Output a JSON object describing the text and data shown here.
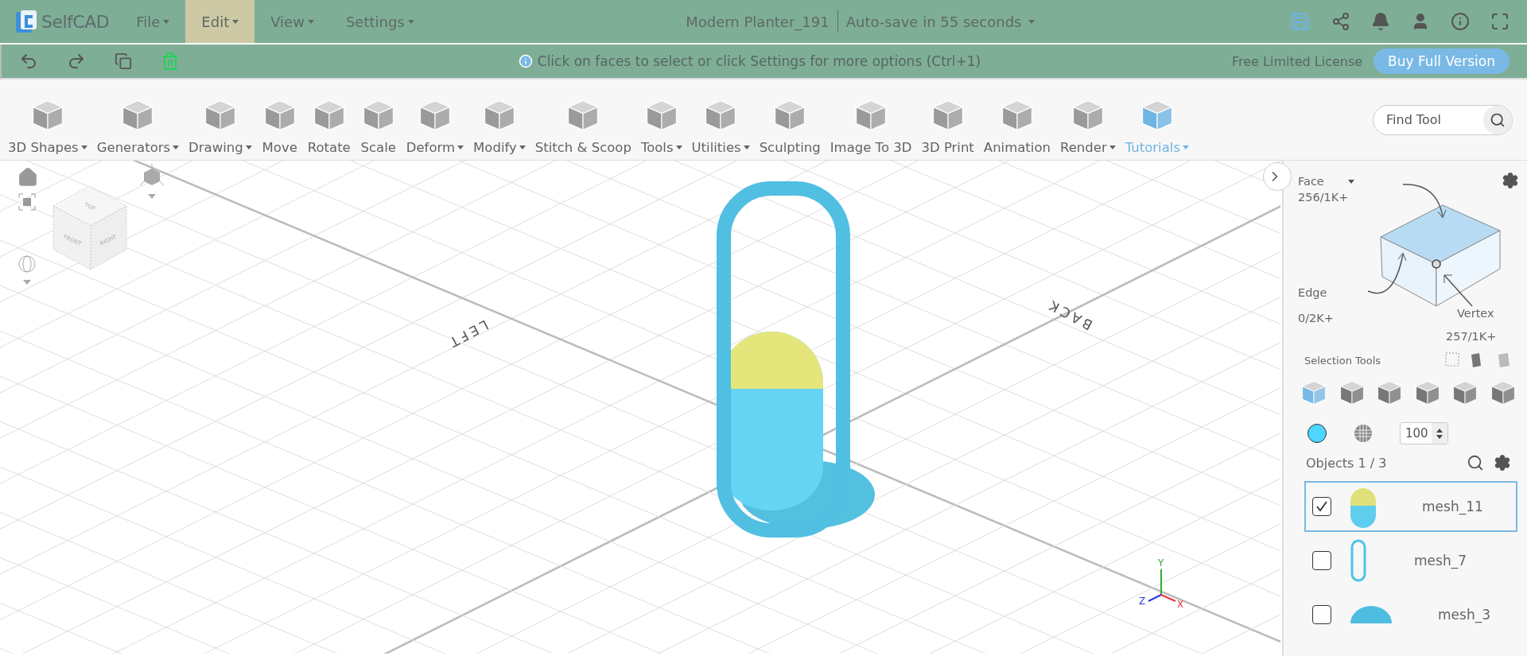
{
  "header": {
    "logo_text": "SelfCAD",
    "menus": [
      {
        "label": "File",
        "selected": false
      },
      {
        "label": "Edit",
        "selected": true
      },
      {
        "label": "View",
        "selected": false
      },
      {
        "label": "Settings",
        "selected": false
      }
    ],
    "title": "Modern Planter_191",
    "autosave": "Auto-save in 55 seconds"
  },
  "action_bar": {
    "hint": "Click on faces to select or click Settings for more options (Ctrl+1)",
    "license": "Free Limited License",
    "buy_button": "Buy Full Version"
  },
  "toolbar": {
    "tools": [
      {
        "label": "3D Shapes",
        "dropdown": true,
        "highlighted": false
      },
      {
        "label": "Generators",
        "dropdown": true,
        "highlighted": false
      },
      {
        "label": "Drawing",
        "dropdown": true,
        "highlighted": false
      },
      {
        "label": "Move",
        "dropdown": false,
        "highlighted": false
      },
      {
        "label": "Rotate",
        "dropdown": false,
        "highlighted": false
      },
      {
        "label": "Scale",
        "dropdown": false,
        "highlighted": false
      },
      {
        "label": "Deform",
        "dropdown": true,
        "highlighted": false
      },
      {
        "label": "Modify",
        "dropdown": true,
        "highlighted": false
      },
      {
        "label": "Stitch & Scoop",
        "dropdown": false,
        "highlighted": false
      },
      {
        "label": "Tools",
        "dropdown": true,
        "highlighted": false
      },
      {
        "label": "Utilities",
        "dropdown": true,
        "highlighted": false
      },
      {
        "label": "Sculpting",
        "dropdown": false,
        "highlighted": false
      },
      {
        "label": "Image To 3D",
        "dropdown": false,
        "highlighted": false
      },
      {
        "label": "3D Print",
        "dropdown": false,
        "highlighted": false
      },
      {
        "label": "Animation",
        "dropdown": false,
        "highlighted": false
      },
      {
        "label": "Render",
        "dropdown": true,
        "highlighted": false
      },
      {
        "label": "Tutorials",
        "dropdown": true,
        "highlighted": true
      }
    ],
    "search": {
      "placeholder": "Find Tool"
    }
  },
  "viewport": {
    "view_cube": {
      "top": "TOP",
      "front": "FRONT",
      "right": "RIGHT"
    },
    "floor_labels": {
      "left": "LEFT",
      "back": "BACK"
    },
    "axes": {
      "x": "X",
      "y": "Y",
      "z": "Z"
    }
  },
  "panel": {
    "mode": "Face",
    "face_count": "256/1K+",
    "edge_label": "Edge",
    "edge_count": "0/2K+",
    "vertex_label": "Vertex",
    "vertex_count": "257/1K+",
    "selection_tools_label": "Selection Tools",
    "selection_modes": [
      {
        "selected": true
      },
      {
        "selected": false
      },
      {
        "selected": false
      },
      {
        "selected": false
      },
      {
        "selected": false
      },
      {
        "selected": false
      }
    ],
    "opacity": "100",
    "objects_label": "Objects 1 / 3",
    "objects": [
      {
        "name": "mesh_11",
        "checked": true,
        "selected": true,
        "kind": "capsule"
      },
      {
        "name": "mesh_7",
        "checked": false,
        "selected": false,
        "kind": "loop"
      },
      {
        "name": "mesh_3",
        "checked": false,
        "selected": false,
        "kind": "dome"
      }
    ]
  }
}
